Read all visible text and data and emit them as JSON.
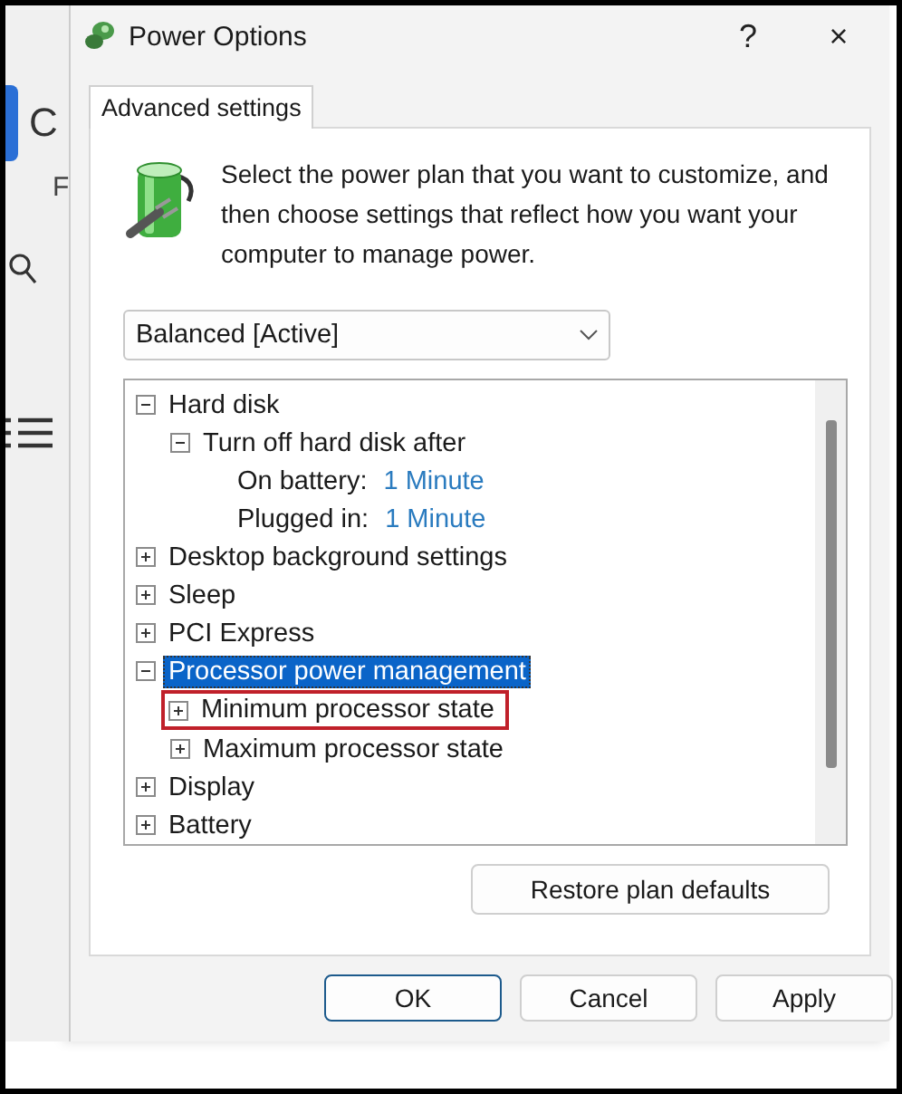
{
  "background_window": {
    "title": "C",
    "subtitle": "F"
  },
  "window": {
    "title": "Power Options",
    "help": "?",
    "close": "×"
  },
  "tabs": [
    {
      "label": "Advanced settings",
      "selected": true
    }
  ],
  "description": "Select the power plan that you want to customize, and then choose settings that reflect how you want your computer to manage power.",
  "plan_select": {
    "value": "Balanced [Active]"
  },
  "tree": [
    {
      "kind": "group",
      "label": "Hard disk",
      "expanded": true,
      "selected": false,
      "highlighted": false,
      "children": [
        {
          "kind": "group",
          "label": "Turn off hard disk after",
          "expanded": true,
          "selected": false,
          "highlighted": false,
          "children": [
            {
              "kind": "setting",
              "label": "On battery:",
              "value": "1 Minute",
              "selected": false,
              "highlighted": false
            },
            {
              "kind": "setting",
              "label": "Plugged in:",
              "value": "1 Minute",
              "selected": false,
              "highlighted": false
            }
          ]
        }
      ]
    },
    {
      "kind": "group",
      "label": "Desktop background settings",
      "expanded": false,
      "selected": false,
      "highlighted": false
    },
    {
      "kind": "group",
      "label": "Sleep",
      "expanded": false,
      "selected": false,
      "highlighted": false
    },
    {
      "kind": "group",
      "label": "PCI Express",
      "expanded": false,
      "selected": false,
      "highlighted": false
    },
    {
      "kind": "group",
      "label": "Processor power management",
      "expanded": true,
      "selected": true,
      "highlighted": false,
      "children": [
        {
          "kind": "group",
          "label": "Minimum processor state",
          "expanded": false,
          "selected": false,
          "highlighted": true
        },
        {
          "kind": "group",
          "label": "Maximum processor state",
          "expanded": false,
          "selected": false,
          "highlighted": false
        }
      ]
    },
    {
      "kind": "group",
      "label": "Display",
      "expanded": false,
      "selected": false,
      "highlighted": false
    },
    {
      "kind": "group",
      "label": "Battery",
      "expanded": false,
      "selected": false,
      "highlighted": false
    }
  ],
  "restore_button": "Restore plan defaults",
  "buttons": [
    {
      "label": "OK",
      "default": true
    },
    {
      "label": "Cancel",
      "default": false
    },
    {
      "label": "Apply",
      "default": false
    }
  ]
}
